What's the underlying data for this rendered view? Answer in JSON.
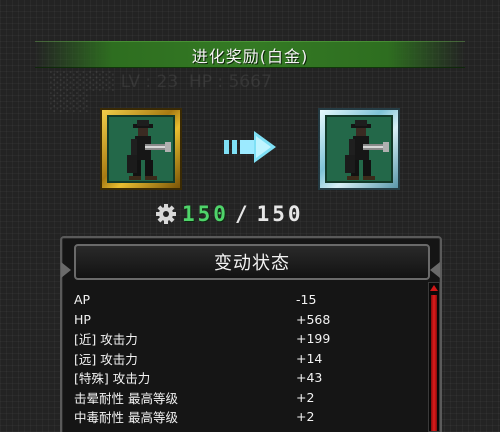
{
  "background_ghost": {
    "line1": "░░░░░ LV : 23  HP : 5667",
    "line2": "░░░"
  },
  "header": {
    "title": "进化奖励(白金)"
  },
  "evolution": {
    "from_rank": "gold",
    "to_rank": "platinum",
    "arrow_icon": "right-arrow-icon",
    "gear_icon": "gear-icon"
  },
  "level": {
    "current": "150",
    "separator": "/",
    "max": "150"
  },
  "status_panel": {
    "title": "变动状态",
    "stats": [
      {
        "name": "AP",
        "value": "-15"
      },
      {
        "name": "HP",
        "value": "+568"
      },
      {
        "name": "[近] 攻击力",
        "value": "+199"
      },
      {
        "name": "[远] 攻击力",
        "value": "+14"
      },
      {
        "name": "[特殊] 攻击力",
        "value": "+43"
      },
      {
        "name": "击晕耐性 最高等级",
        "value": "+2"
      },
      {
        "name": "中毒耐性 最高等级",
        "value": "+2"
      }
    ]
  },
  "colors": {
    "banner_green": "#347a24",
    "level_current": "#4fd36a",
    "gold_frame": "#e8bd30",
    "platinum_frame": "#7fc3d6",
    "scroll_red": "#e01c1c",
    "arrow_cyan": "#7fe0f5"
  }
}
